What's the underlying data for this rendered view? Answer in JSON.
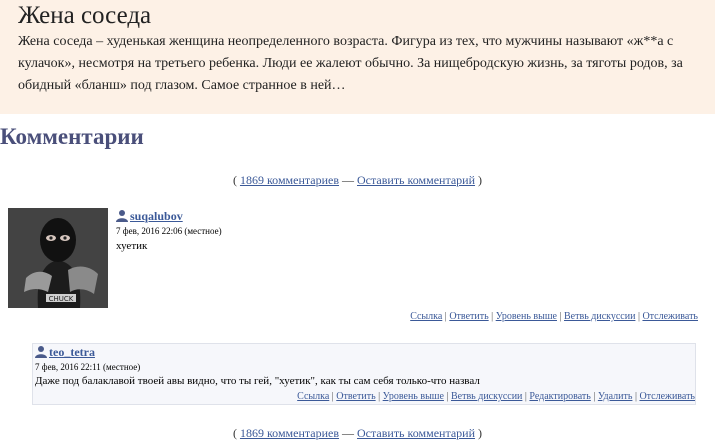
{
  "post": {
    "title": "Жена соседа",
    "excerpt": "Жена соседа – худенькая женщина неопределенного возраста. Фигура из тех, что мужчины называют «ж**а с кулачок», несмотря на третьего ребенка. Люди ее жалеют обычно. За нищебродскую жизнь, за тяготы родов, за обидный «бланш» под глазом. Самое странное в ней…"
  },
  "comments_section": {
    "heading": "Комментарии",
    "nav": {
      "open": "( ",
      "count_link": "1869 комментариев",
      "sep": " — ",
      "leave_link": "Оставить комментарий",
      "close": " )"
    },
    "comments": [
      {
        "username": "suqalubov",
        "time": "7 фев, 2016 22:06",
        "time_note": "(местное)",
        "text": "хуетик",
        "avatar_caption": "CHUCK",
        "actions": [
          "Ссылка",
          "Ответить",
          "Уровень выше",
          "Ветвь дискуссии",
          "Отслеживать"
        ]
      },
      {
        "username": "teo_tetra",
        "time": "7 фев, 2016 22:11",
        "time_note": "(местное)",
        "text": "Даже под балаклавой твоей авы видно, что ты гей, \"хуетик\", как ты сам себя только-что назвал",
        "actions": [
          "Ссылка",
          "Ответить",
          "Уровень выше",
          "Ветвь дискуссии",
          "Редактировать",
          "Удалить",
          "Отслеживать"
        ]
      }
    ],
    "action_separator": " | "
  },
  "colors": {
    "post_background": "#fdf1e6",
    "heading": "#4a4f7a",
    "link": "#3b5998"
  },
  "icons": [
    "user-icon"
  ]
}
